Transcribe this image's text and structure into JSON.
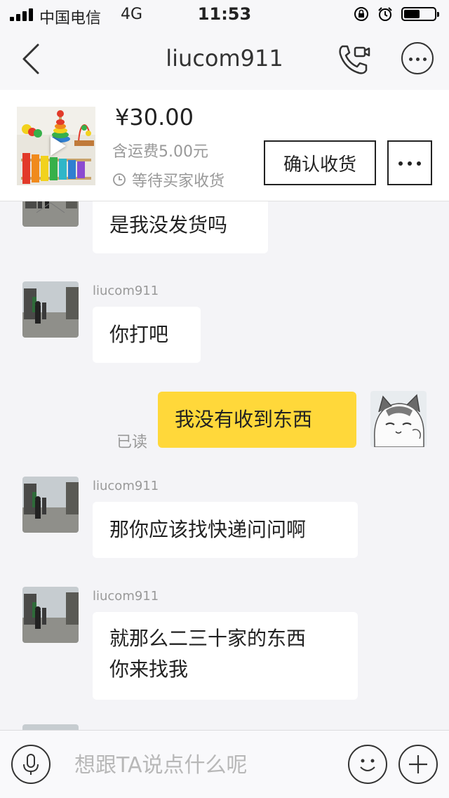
{
  "status_bar": {
    "carrier": "中国电信",
    "network": "4G",
    "time": "11:53",
    "icons": [
      "signal-icon",
      "orientation-lock-icon",
      "alarm-icon",
      "battery-icon"
    ]
  },
  "nav": {
    "title": "liucom911",
    "icons": [
      "back-chevron-icon",
      "video-call-icon",
      "more-icon"
    ]
  },
  "product": {
    "price": "¥30.00",
    "shipping": "含运费5.00元",
    "status": "等待买家收货",
    "confirm_label": "确认收货",
    "icons": [
      "product-thumbnail",
      "play-icon",
      "clock-icon",
      "more-icon"
    ]
  },
  "messages": [
    {
      "side": "left",
      "sender": "",
      "text": "是我没发货吗"
    },
    {
      "side": "left",
      "sender": "liucom911",
      "text": "你打吧"
    },
    {
      "side": "right",
      "read": "已读",
      "text": "我没有收到东西"
    },
    {
      "side": "left",
      "sender": "liucom911",
      "text": "那你应该找快递问问啊"
    },
    {
      "side": "left",
      "sender": "liucom911",
      "text": "就那么二三十家的东西你来找我",
      "lines": [
        "就那么二三十家的东西",
        "你来找我"
      ]
    }
  ],
  "input": {
    "placeholder": "想跟TA说点什么呢",
    "value": "",
    "icons": [
      "microphone-icon",
      "emoji-icon",
      "plus-icon"
    ]
  },
  "colors": {
    "my_bubble": "#ffd83a",
    "their_bubble": "#ffffff",
    "chat_background": "#f4f4f7"
  }
}
